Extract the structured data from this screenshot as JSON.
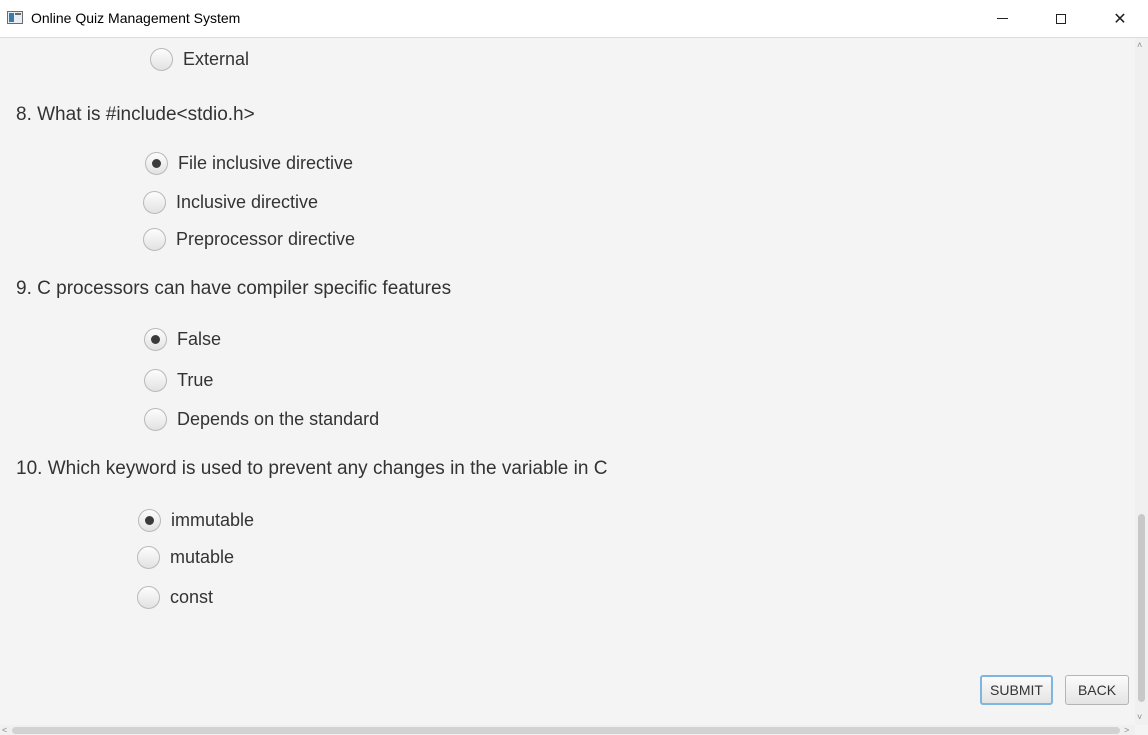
{
  "window": {
    "title": "Online Quiz Management System",
    "minimize_icon": "minimize-icon",
    "maximize_icon": "maximize-icon",
    "close_icon": "close-icon",
    "close_glyph": "✕"
  },
  "questions": [
    {
      "text": "",
      "options": [
        {
          "label": "External",
          "selected": false
        }
      ]
    },
    {
      "text": "8.  What is #include<stdio.h>",
      "options": [
        {
          "label": "File inclusive directive",
          "selected": true
        },
        {
          "label": "Inclusive directive",
          "selected": false
        },
        {
          "label": "Preprocessor directive",
          "selected": false
        }
      ]
    },
    {
      "text": "9.  C processors can have compiler specific features",
      "options": [
        {
          "label": "False",
          "selected": true
        },
        {
          "label": "True",
          "selected": false
        },
        {
          "label": "Depends on the standard",
          "selected": false
        }
      ]
    },
    {
      "text": "10.  Which keyword is used to prevent any changes in the variable in C",
      "options": [
        {
          "label": "immutable",
          "selected": true
        },
        {
          "label": "mutable",
          "selected": false
        },
        {
          "label": "const",
          "selected": false
        }
      ]
    }
  ],
  "buttons": {
    "submit": "SUBMIT",
    "back": "BACK"
  },
  "scrollbar": {
    "up_arrow": "˄",
    "down_arrow": "˅",
    "left_arrow": "<",
    "right_arrow": ">"
  },
  "colors": {
    "focus_ring": "#7fb6df",
    "background": "#f4f4f4"
  }
}
